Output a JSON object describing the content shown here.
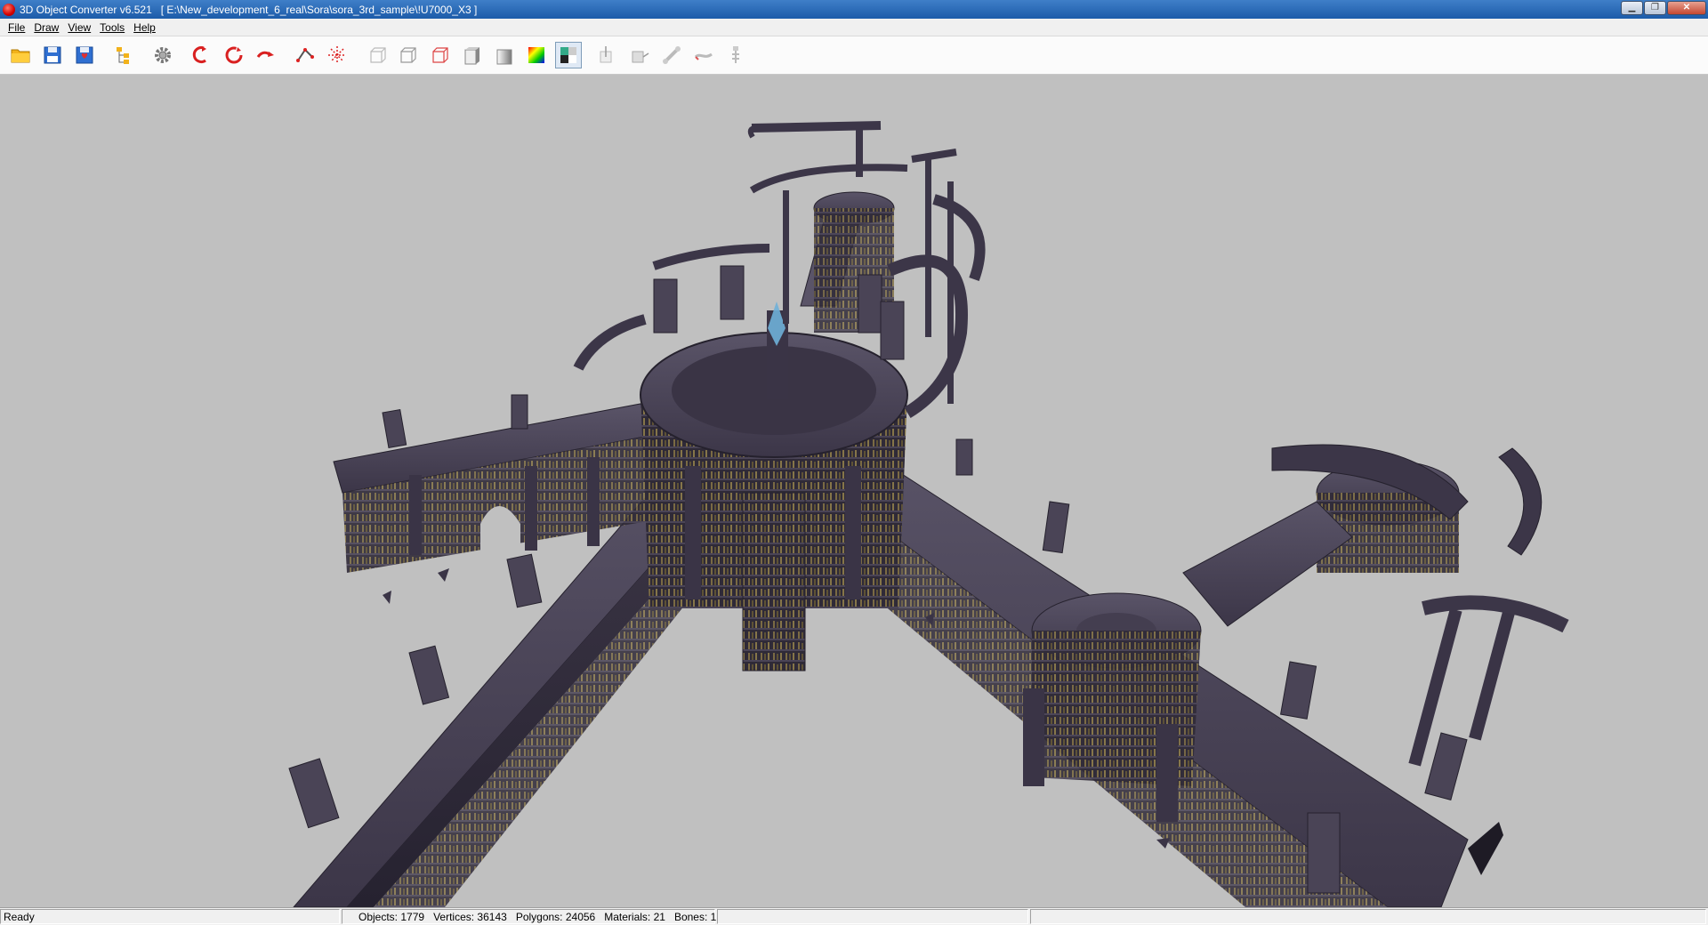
{
  "window": {
    "app_title": "3D Object Converter v6.521",
    "document_path": "[ E:\\New_development_6_real\\Sora\\sora_3rd_sample\\!U7000_X3 ]"
  },
  "menu": {
    "items": [
      {
        "label": "File"
      },
      {
        "label": "Draw"
      },
      {
        "label": "View"
      },
      {
        "label": "Tools"
      },
      {
        "label": "Help"
      }
    ]
  },
  "toolbar": {
    "buttons": [
      {
        "icon": "open-folder-icon"
      },
      {
        "icon": "save-icon"
      },
      {
        "icon": "save-as-icon"
      },
      {
        "icon": "object-tree-icon"
      },
      {
        "icon": "settings-gear-icon"
      },
      {
        "icon": "rotate-x-icon"
      },
      {
        "icon": "rotate-y-icon"
      },
      {
        "icon": "rotate-z-icon"
      },
      {
        "icon": "vertices-icon"
      },
      {
        "icon": "bounding-box-icon"
      },
      {
        "icon": "wireframe-icon"
      },
      {
        "icon": "wireframe-hidden-icon"
      },
      {
        "icon": "wireframe-color-icon"
      },
      {
        "icon": "flat-shading-icon"
      },
      {
        "icon": "smooth-shading-icon"
      },
      {
        "icon": "vertex-color-icon"
      },
      {
        "icon": "texture-icon",
        "active": true
      },
      {
        "icon": "normals-icon"
      },
      {
        "icon": "face-normals-icon"
      },
      {
        "icon": "bones-icon"
      },
      {
        "icon": "animation-icon"
      },
      {
        "icon": "skeleton-icon"
      }
    ]
  },
  "status": {
    "ready": "Ready",
    "objects": "Objects: 1779",
    "vertices": "Vertices: 36143",
    "polygons": "Polygons: 24056",
    "materials": "Materials: 21",
    "bones": "Bones: 1"
  },
  "colors": {
    "viewport_bg": "#c0c0c0",
    "stone": "#4a4456",
    "stone_dark": "#2e2a38",
    "stone_light": "#6b6478",
    "trim_gold": "#8a7a52",
    "crystal": "#6fb0d8"
  }
}
